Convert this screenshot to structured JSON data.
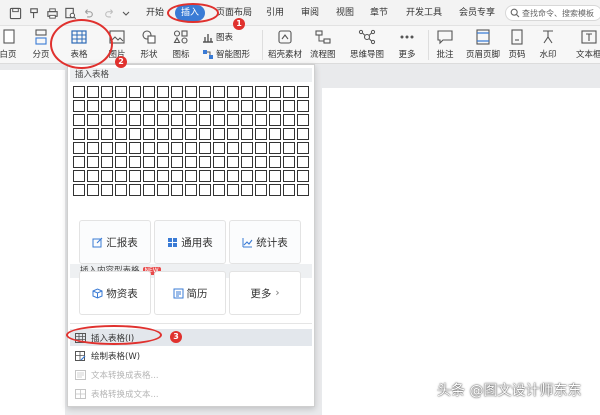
{
  "menubar": {
    "tabs": [
      "开始",
      "插入",
      "页面布局",
      "引用",
      "审阅",
      "视图",
      "章节",
      "开发工具",
      "会员专享"
    ],
    "active_tab": "插入",
    "search_placeholder": "查找命令、搜索模板"
  },
  "ribbon": {
    "buttons": [
      "白页",
      "分页",
      "表格",
      "图片",
      "形状",
      "图标",
      "智能图形",
      "稻壳素材",
      "流程图",
      "思维导图",
      "更多",
      "批注",
      "页眉页脚",
      "页码",
      "水印",
      "文本框"
    ],
    "chart_label": "图表"
  },
  "dropdown": {
    "header": "插入表格",
    "grid_rows": 8,
    "grid_cols": 17,
    "section_title": "插入内容型表格",
    "badge": "NEW",
    "cards": [
      "汇报表",
      "通用表",
      "统计表",
      "物资表",
      "简历",
      "更多"
    ],
    "more_chevron": "›",
    "menu_items": [
      "插入表格(I)",
      "绘制表格(W)",
      "文本转换成表格...",
      "表格转换成文本..."
    ]
  },
  "annotations": [
    "1",
    "2",
    "3"
  ],
  "watermark": "头条 @图文设计师东东",
  "colors": {
    "accent": "#3a7bd5",
    "annotation": "#e0312e",
    "badge": "#e84a4a"
  }
}
